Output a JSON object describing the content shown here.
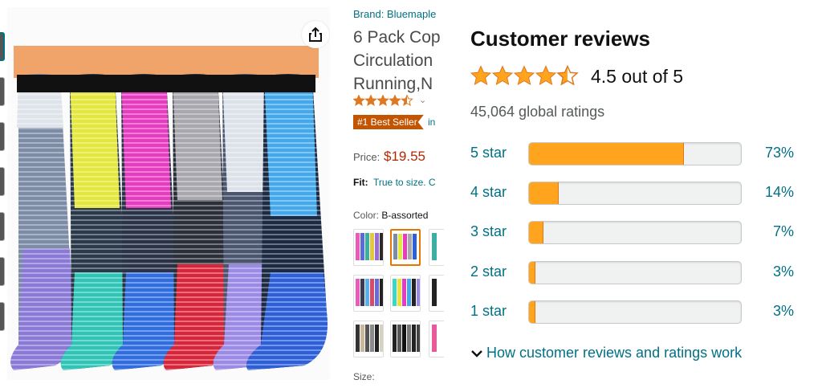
{
  "product": {
    "brand": "Brand: Bluemaple",
    "title_lines": [
      "6 Pack Cop",
      "Circulation",
      "Running,N"
    ],
    "rating_stars": 4.5,
    "best_seller_badge": "#1 Best Seller",
    "best_seller_in": "in",
    "price_label": "Price:",
    "price": "$19.55",
    "fit_label": "Fit:",
    "fit_value": "True to size. C",
    "color_label": "Color:",
    "color_value": "B-assorted",
    "size_label": "Size:"
  },
  "reviews": {
    "title": "Customer reviews",
    "average_stars": 4.5,
    "out_of": "4.5 out of 5",
    "global_ratings": "45,064 global ratings",
    "histogram": [
      {
        "label": "5 star",
        "percent": 73,
        "percent_text": "73%"
      },
      {
        "label": "4 star",
        "percent": 14,
        "percent_text": "14%"
      },
      {
        "label": "3 star",
        "percent": 7,
        "percent_text": "7%"
      },
      {
        "label": "2 star",
        "percent": 3,
        "percent_text": "3%"
      },
      {
        "label": "1 star",
        "percent": 3,
        "percent_text": "3%"
      }
    ],
    "how_link": "How customer reviews and ratings work"
  },
  "icons": {
    "share": "share-icon",
    "star": "star-icon",
    "chevron": "chevron-down-icon"
  },
  "colors": {
    "link": "#007185",
    "star": "#ffa41c",
    "price": "#b12704",
    "badge": "#c45500"
  }
}
